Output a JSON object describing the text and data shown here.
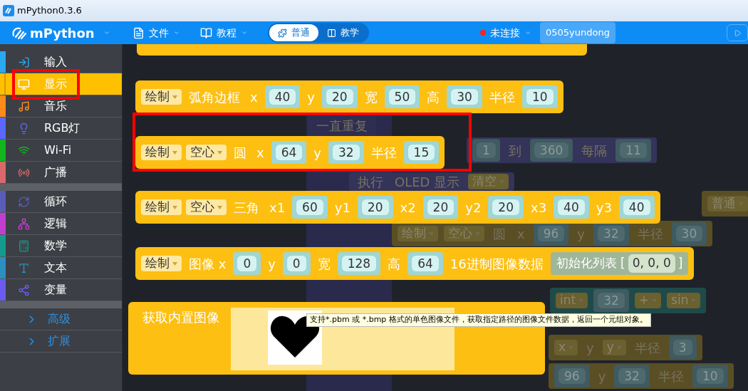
{
  "window": {
    "title": "mPython0.3.6"
  },
  "header": {
    "logo": "mPython",
    "menus": [
      {
        "label": "文件",
        "kind": "file"
      },
      {
        "label": "教程",
        "kind": "book"
      }
    ],
    "modes": [
      {
        "label": "普通",
        "kind": "blocks",
        "selected": true
      },
      {
        "label": "教学",
        "kind": "book",
        "selected": false
      }
    ],
    "status": {
      "label": "未连接",
      "connected": false
    },
    "device": "0505yundong"
  },
  "sidebar": {
    "sections": [
      {
        "items": [
          {
            "label": "输入",
            "kind": "input",
            "color": "#2aa8f0",
            "selected": false
          },
          {
            "label": "显示",
            "kind": "display",
            "color": "#ffc000",
            "selected": true
          },
          {
            "label": "音乐",
            "kind": "music",
            "color": "#ff8c1a",
            "selected": false
          },
          {
            "label": "RGB灯",
            "kind": "rgb",
            "color": "#5b67ff",
            "selected": false
          },
          {
            "label": "Wi-Fi",
            "kind": "wifi",
            "color": "#12b51e",
            "selected": false
          },
          {
            "label": "广播",
            "kind": "radio",
            "color": "#d9686a",
            "selected": false
          }
        ]
      },
      {
        "items": [
          {
            "label": "循环",
            "kind": "loop",
            "color": "#5b5cb8",
            "selected": false
          },
          {
            "label": "逻辑",
            "kind": "logic",
            "color": "#c03fd0",
            "selected": false
          },
          {
            "label": "数学",
            "kind": "math",
            "color": "#159a8e",
            "selected": false
          },
          {
            "label": "文本",
            "kind": "text",
            "color": "#2d8fc0",
            "selected": false
          },
          {
            "label": "变量",
            "kind": "variable",
            "color": "#6a5cf0",
            "selected": false
          }
        ]
      },
      {
        "items": [
          {
            "label": "高级",
            "kind": "more",
            "selected": false
          },
          {
            "label": "扩展",
            "kind": "more",
            "selected": false
          }
        ]
      }
    ]
  },
  "background_blocks": [
    {
      "color": "#2e2d52",
      "parts": [
        {
          "kind": "label",
          "text": "一直重复"
        }
      ]
    },
    {
      "color": "#34335a",
      "parts": [
        {
          "kind": "number",
          "text": "1"
        },
        {
          "kind": "label",
          "text": "到"
        },
        {
          "kind": "number",
          "text": "360"
        },
        {
          "kind": "label",
          "text": "每隔"
        },
        {
          "kind": "number",
          "text": "11"
        }
      ]
    },
    {
      "color": "#34335a",
      "parts": [
        {
          "kind": "label",
          "text": "执行"
        },
        {
          "kind": "label",
          "text": "OLED 显示"
        },
        {
          "kind": "dropdown",
          "text": "清空"
        }
      ]
    },
    {
      "color": "#5a4e25",
      "parts": [
        {
          "kind": "dropdown",
          "text": "普通"
        }
      ]
    },
    {
      "color": "#5a4e25",
      "parts": [
        {
          "kind": "dropdown",
          "text": "绘制"
        },
        {
          "kind": "dropdown",
          "text": "空心"
        },
        {
          "kind": "label",
          "text": "圆"
        },
        {
          "kind": "label",
          "text": "x"
        },
        {
          "kind": "number",
          "text": "96"
        },
        {
          "kind": "label",
          "text": "y"
        },
        {
          "kind": "number",
          "text": "32"
        },
        {
          "kind": "label",
          "text": "半径"
        },
        {
          "kind": "number",
          "text": "30"
        }
      ]
    },
    {
      "color": "#1f4a4a",
      "parts": [
        {
          "kind": "dropdown",
          "text": "int"
        },
        {
          "kind": "number",
          "text": "32"
        },
        {
          "kind": "dropdown",
          "text": "+"
        },
        {
          "kind": "dropdown",
          "text": "sin"
        }
      ]
    },
    {
      "color": "#5a4e25",
      "parts": [
        {
          "kind": "dropdown",
          "text": "x"
        },
        {
          "kind": "label",
          "text": "y"
        },
        {
          "kind": "dropdown",
          "text": "y"
        },
        {
          "kind": "label",
          "text": "半径"
        },
        {
          "kind": "number",
          "text": "3"
        }
      ]
    },
    {
      "color": "#5a4e25",
      "parts": [
        {
          "kind": "number",
          "text": "96"
        },
        {
          "kind": "label",
          "text": "y"
        },
        {
          "kind": "number",
          "text": "32"
        },
        {
          "kind": "label",
          "text": "半径"
        },
        {
          "kind": "number",
          "text": "10"
        }
      ]
    }
  ],
  "blocks": [
    {
      "kind": "statement",
      "highlighted": false,
      "parts": [
        {
          "kind": "dropdown",
          "text": "绘制"
        },
        {
          "kind": "label",
          "text": "弧角边框"
        },
        {
          "kind": "label",
          "text": "x"
        },
        {
          "kind": "number",
          "text": "40"
        },
        {
          "kind": "label",
          "text": "y"
        },
        {
          "kind": "number",
          "text": "20"
        },
        {
          "kind": "label",
          "text": "宽"
        },
        {
          "kind": "number",
          "text": "50"
        },
        {
          "kind": "label",
          "text": "高"
        },
        {
          "kind": "number",
          "text": "30"
        },
        {
          "kind": "label",
          "text": "半径"
        },
        {
          "kind": "number",
          "text": "10"
        }
      ]
    },
    {
      "kind": "statement",
      "highlighted": true,
      "parts": [
        {
          "kind": "dropdown",
          "text": "绘制"
        },
        {
          "kind": "dropdown",
          "text": "空心"
        },
        {
          "kind": "label",
          "text": "圆"
        },
        {
          "kind": "label",
          "text": "x"
        },
        {
          "kind": "number",
          "text": "64"
        },
        {
          "kind": "label",
          "text": "y"
        },
        {
          "kind": "number",
          "text": "32"
        },
        {
          "kind": "label",
          "text": "半径"
        },
        {
          "kind": "number",
          "text": "15"
        }
      ]
    },
    {
      "kind": "statement",
      "highlighted": false,
      "parts": [
        {
          "kind": "dropdown",
          "text": "绘制"
        },
        {
          "kind": "dropdown",
          "text": "空心"
        },
        {
          "kind": "label",
          "text": "三角"
        },
        {
          "kind": "label",
          "text": "x1"
        },
        {
          "kind": "number",
          "text": "60"
        },
        {
          "kind": "label",
          "text": "y1"
        },
        {
          "kind": "number",
          "text": "20"
        },
        {
          "kind": "label",
          "text": "x2"
        },
        {
          "kind": "number",
          "text": "20"
        },
        {
          "kind": "label",
          "text": "y2"
        },
        {
          "kind": "number",
          "text": "20"
        },
        {
          "kind": "label",
          "text": "x3"
        },
        {
          "kind": "number",
          "text": "40"
        },
        {
          "kind": "label",
          "text": "y3"
        },
        {
          "kind": "number",
          "text": "40"
        }
      ]
    },
    {
      "kind": "statement",
      "highlighted": false,
      "parts": [
        {
          "kind": "dropdown",
          "text": "绘制"
        },
        {
          "kind": "label",
          "text": "图像 x"
        },
        {
          "kind": "number",
          "text": "0"
        },
        {
          "kind": "label",
          "text": "y"
        },
        {
          "kind": "number",
          "text": "0"
        },
        {
          "kind": "label",
          "text": "宽"
        },
        {
          "kind": "number",
          "text": "128"
        },
        {
          "kind": "label",
          "text": "高"
        },
        {
          "kind": "number",
          "text": "64"
        },
        {
          "kind": "label",
          "text": "16进制图像数据"
        },
        {
          "kind": "list",
          "text": "初始化列表 [",
          "value": "0, 0, 0",
          "end": "]"
        }
      ]
    },
    {
      "kind": "image",
      "highlighted": false,
      "parts": [
        {
          "kind": "label",
          "text": "获取内置图像"
        }
      ]
    }
  ],
  "tooltip": "支持*.pbm 或 *.bmp 格式的单色图像文件，获取指定路径的图像文件数据，返回一个元组对象。"
}
